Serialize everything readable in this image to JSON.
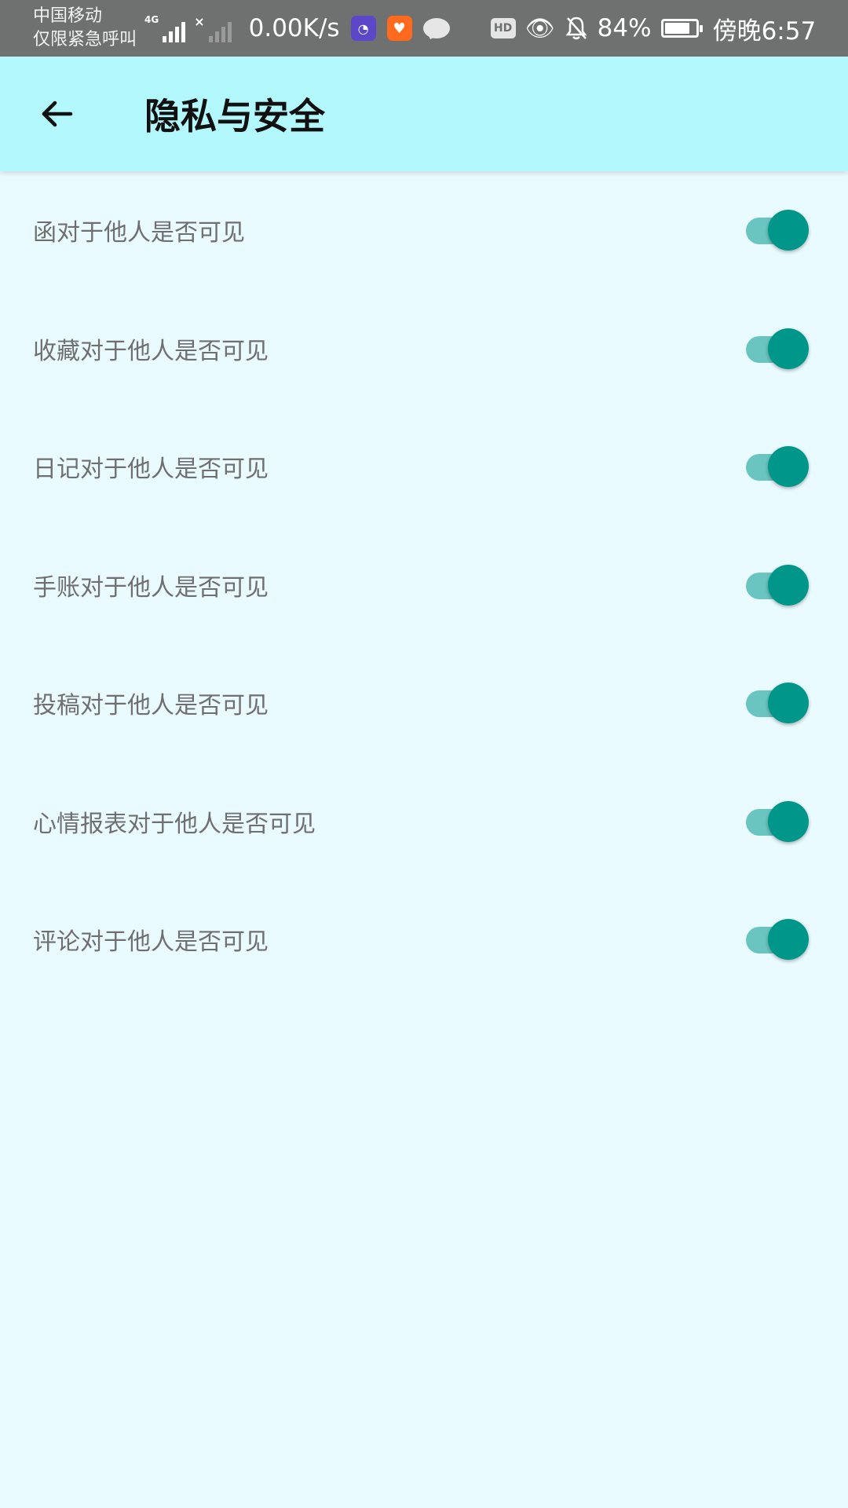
{
  "status_bar": {
    "carrier_line1": "中国移动",
    "carrier_line2": "仅限紧急呼叫",
    "network": "4G",
    "net_speed": "0.00K/s",
    "hd_label": "HD",
    "battery_percent": "84%",
    "battery_level": 0.84,
    "time": "傍晚6:57"
  },
  "header": {
    "title": "隐私与安全"
  },
  "colors": {
    "accent": "#00978a",
    "header_bg": "#b2f8fc",
    "page_bg": "#eafbff",
    "status_bg": "#6f7070"
  },
  "settings": [
    {
      "label": "函对于他人是否可见",
      "enabled": true
    },
    {
      "label": "收藏对于他人是否可见",
      "enabled": true
    },
    {
      "label": "日记对于他人是否可见",
      "enabled": true
    },
    {
      "label": "手账对于他人是否可见",
      "enabled": true
    },
    {
      "label": "投稿对于他人是否可见",
      "enabled": true
    },
    {
      "label": "心情报表对于他人是否可见",
      "enabled": true
    },
    {
      "label": "评论对于他人是否可见",
      "enabled": true
    }
  ]
}
